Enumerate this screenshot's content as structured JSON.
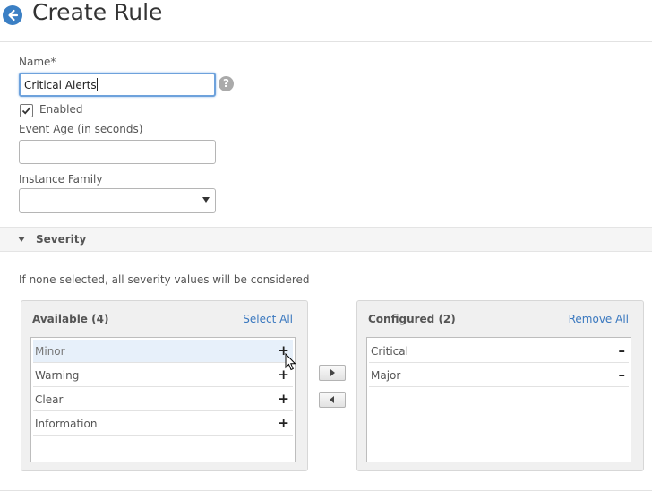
{
  "header": {
    "title": "Create Rule",
    "back_icon": "back-arrow-icon"
  },
  "form": {
    "name_label": "Name*",
    "name_value": "Critical Alerts",
    "help_icon": "?",
    "enabled_label": "Enabled",
    "enabled_checked": true,
    "event_age_label": "Event Age (in seconds)",
    "event_age_value": "",
    "instance_family_label": "Instance Family",
    "instance_family_value": ""
  },
  "severity": {
    "section_title": "Severity",
    "hint": "If none selected, all severity values will be considered",
    "available": {
      "title": "Available (4)",
      "select_all": "Select All",
      "items": [
        {
          "label": "Minor",
          "symbol": "+"
        },
        {
          "label": "Warning",
          "symbol": "+"
        },
        {
          "label": "Clear",
          "symbol": "+"
        },
        {
          "label": "Information",
          "symbol": "+"
        }
      ]
    },
    "configured": {
      "title": "Configured (2)",
      "remove_all": "Remove All",
      "items": [
        {
          "label": "Critical",
          "symbol": "–"
        },
        {
          "label": "Major",
          "symbol": "–"
        }
      ]
    }
  },
  "colors": {
    "accent": "#3a78bf",
    "back_button": "#3b7fc4",
    "focus_border": "#6ea2dc"
  }
}
